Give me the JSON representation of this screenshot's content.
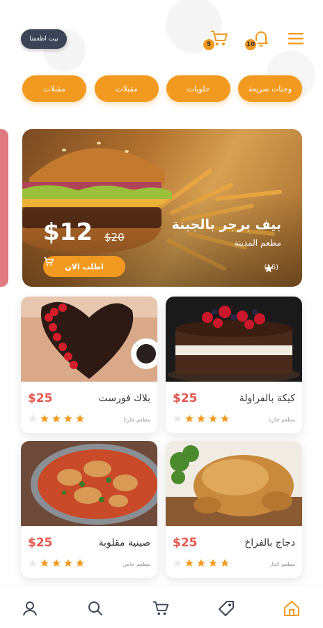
{
  "header": {
    "user_pill": "بيت اطعمنا",
    "cart_count": "5",
    "notif_count": "10"
  },
  "categories": [
    "وجبات سريعة",
    "حلويات",
    "مقبلات",
    "مقبلات"
  ],
  "hero": {
    "title": "بيف برجر بالجبنة",
    "restaurant": "مطعم المدينة",
    "rating_count": "(16)",
    "price": "$12",
    "old_price": "$20",
    "order_label": "اطلب الان"
  },
  "products": [
    {
      "name": "كيكة بالفراولة",
      "price": "$25",
      "restaurant": "مطعم جارنا",
      "rating": 4
    },
    {
      "name": "بلاك فورست",
      "price": "$25",
      "restaurant": "مطعم جارنا",
      "rating": 4
    },
    {
      "name": "دجاج بالفراخ",
      "price": "$25",
      "restaurant": "مطعم الدار",
      "rating": 4
    },
    {
      "name": "صينية مقلوبة",
      "price": "$25",
      "restaurant": "مطعم خاص",
      "rating": 4
    }
  ],
  "colors": {
    "accent": "#f29a1f",
    "price": "#e4574f",
    "pill": "#3a4456"
  },
  "icons": {
    "nav": [
      "home-icon",
      "tag-icon",
      "cart-icon",
      "search-icon",
      "user-icon"
    ]
  }
}
